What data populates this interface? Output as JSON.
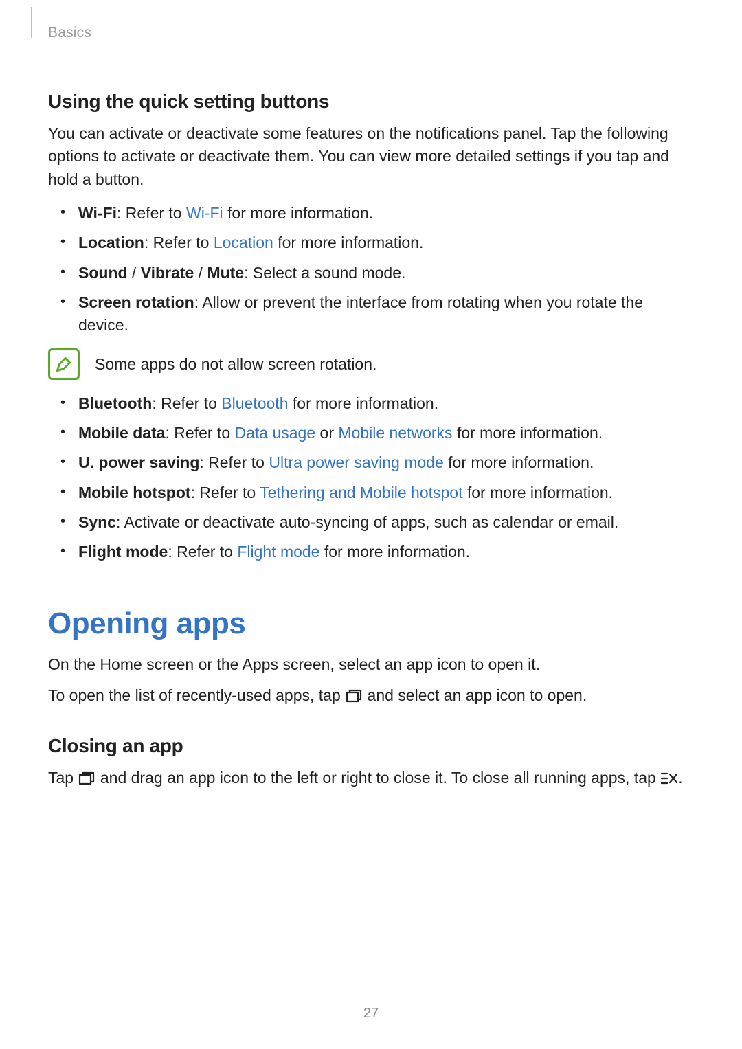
{
  "header": {
    "chapter": "Basics"
  },
  "section_quick": {
    "heading": "Using the quick setting buttons",
    "intro": "You can activate or deactivate some features on the notifications panel. Tap the following options to activate or deactivate them. You can view more detailed settings if you tap and hold a button.",
    "items1": {
      "wifi": {
        "label": "Wi-Fi",
        "t1": ": Refer to ",
        "link": "Wi-Fi",
        "t2": " for more information."
      },
      "loc": {
        "label": "Location",
        "t1": ": Refer to ",
        "link": "Location",
        "t2": " for more information."
      },
      "sound": {
        "label_a": "Sound",
        "sep1": " / ",
        "label_b": "Vibrate",
        "sep2": " / ",
        "label_c": "Mute",
        "t1": ": Select a sound mode."
      },
      "rot": {
        "label": "Screen rotation",
        "t1": ": Allow or prevent the interface from rotating when you rotate the device."
      }
    },
    "note": "Some apps do not allow screen rotation.",
    "items2": {
      "bt": {
        "label": "Bluetooth",
        "t1": ": Refer to ",
        "link": "Bluetooth",
        "t2": " for more information."
      },
      "mdata": {
        "label": "Mobile data",
        "t1": ": Refer to ",
        "link_a": "Data usage",
        "sep": " or ",
        "link_b": "Mobile networks",
        "t2": " for more information."
      },
      "upower": {
        "label": "U. power saving",
        "t1": ": Refer to ",
        "link": "Ultra power saving mode",
        "t2": " for more information."
      },
      "hotspot": {
        "label": "Mobile hotspot",
        "t1": ": Refer to ",
        "link": "Tethering and Mobile hotspot",
        "t2": " for more information."
      },
      "sync": {
        "label": "Sync",
        "t1": ": Activate or deactivate auto-syncing of apps, such as calendar or email."
      },
      "flight": {
        "label": "Flight mode",
        "t1": ": Refer to ",
        "link": "Flight mode",
        "t2": " for more information."
      }
    }
  },
  "section_open": {
    "heading": "Opening apps",
    "p1": "On the Home screen or the Apps screen, select an app icon to open it.",
    "p2a": "To open the list of recently-used apps, tap ",
    "p2b": " and select an app icon to open."
  },
  "section_close": {
    "heading": "Closing an app",
    "p1a": "Tap ",
    "p1b": " and drag an app icon to the left or right to close it. To close all running apps, tap ",
    "p1c": "."
  },
  "page_number": "27"
}
